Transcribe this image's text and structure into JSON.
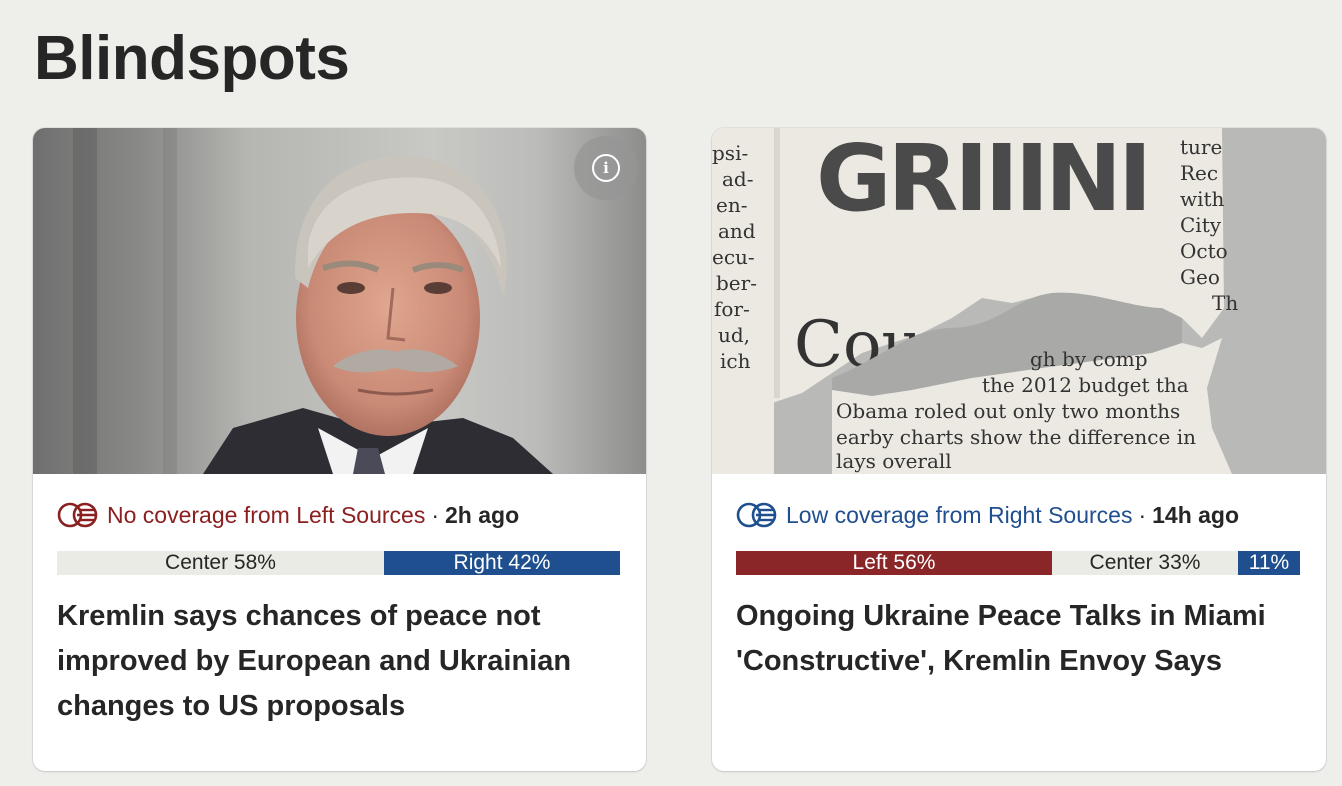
{
  "section": {
    "title": "Blindspots"
  },
  "colors": {
    "left": "#8a2628",
    "center": "#ebebe6",
    "right": "#204f8f",
    "left_text": "#8b2020",
    "right_text": "#204f8f"
  },
  "cards": [
    {
      "image": "man-in-suit-photo",
      "info_icon": "info-icon",
      "blindspot_icon": "blindspot-circles-icon",
      "coverage": "No coverage from Left Sources",
      "time": "2h ago",
      "bias_bar": [
        {
          "label": "Center 58%",
          "bias": "center",
          "pct": 58
        },
        {
          "label": "Right 42%",
          "bias": "right",
          "pct": 42
        }
      ],
      "headline": "Kremlin says chances of peace not improved by European and Ukrainian changes to US proposals"
    },
    {
      "image": "torn-newspaper-image",
      "blindspot_icon": "blindspot-circles-icon",
      "coverage": "Low coverage from Right Sources",
      "time": "14h ago",
      "bias_bar": [
        {
          "label": "Left 56%",
          "bias": "left",
          "pct": 56
        },
        {
          "label": "Center 33%",
          "bias": "center",
          "pct": 33
        },
        {
          "label": "11%",
          "bias": "right",
          "pct": 11
        }
      ],
      "headline": "Ongoing Ukraine Peace Talks in Miami 'Constructive', Kremlin Envoy Says"
    }
  ],
  "newspaper_text": {
    "masthead": "GRIIINI",
    "left_column": [
      "psi-",
      "ad-",
      "en-",
      "and",
      "ecu-",
      "ber-",
      "for-",
      "ud,",
      "ich"
    ],
    "right_column": [
      "ture",
      "Rec",
      "with",
      "City",
      "Octo",
      "Geo",
      "Th"
    ],
    "headline": "Cour",
    "lines": [
      "gh by comp",
      "the 2012 budget tha",
      "Obama roled out only two months",
      "earby charts show the difference in",
      "lays overall"
    ]
  }
}
